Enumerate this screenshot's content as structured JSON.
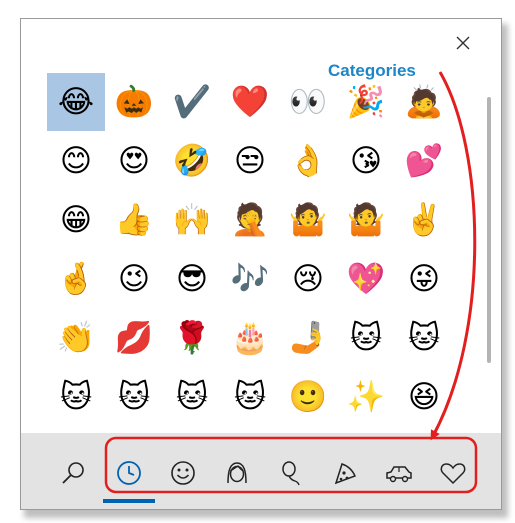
{
  "annotation": {
    "label": "Categories",
    "label_color": "#1c86c8",
    "highlight_color": "#e31e1e"
  },
  "colors": {
    "accent": "#0063b1",
    "selection": "#a9c6e4",
    "bottom_bar": "#e3e3e3"
  },
  "close_icon": "close-icon",
  "selected_index": 0,
  "emoji_grid": [
    "😂",
    "🎃",
    "✔️",
    "❤️",
    "👀",
    "🎉",
    "🙇",
    "😊",
    "😍",
    "🤣",
    "😒",
    "👌",
    "😘",
    "💕",
    "😁",
    "👍",
    "🙌",
    "🤦",
    "🤷",
    "🤷",
    "✌️",
    "🤞",
    "😉",
    "😎",
    "🎶",
    "😢",
    "💖",
    "😜",
    "👏",
    "💋",
    "🌹",
    "🎂",
    "🤳",
    "🐱",
    "🐱",
    "🐱",
    "🐱",
    "🐱",
    "🐱",
    "🙂",
    "✨",
    "😆"
  ],
  "category_tabs": [
    {
      "icon": "search-icon",
      "active": false
    },
    {
      "icon": "clock-icon",
      "active": true
    },
    {
      "icon": "smiley-icon",
      "active": false
    },
    {
      "icon": "person-icon",
      "active": false
    },
    {
      "icon": "balloon-icon",
      "active": false
    },
    {
      "icon": "pizza-icon",
      "active": false
    },
    {
      "icon": "car-icon",
      "active": false
    },
    {
      "icon": "heart-icon",
      "active": false
    }
  ]
}
